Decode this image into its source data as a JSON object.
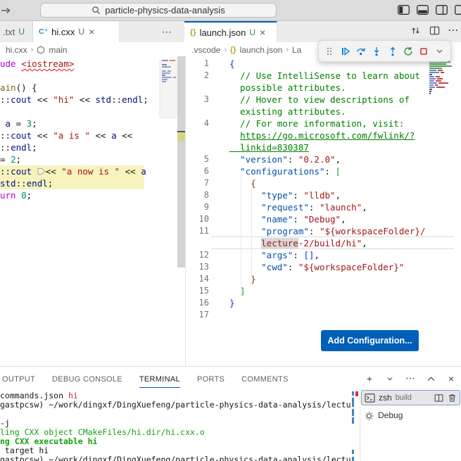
{
  "titlebar": {
    "command_center": "particle-physics-data-analysis"
  },
  "editor_tabs": {
    "left": [
      {
        "label": ".txt",
        "badge": "U"
      },
      {
        "label": "hi.cxx",
        "badge": "U"
      }
    ],
    "right": [
      {
        "label": "launch.json",
        "badge": "U"
      }
    ],
    "more_glyph": "⋯",
    "close_glyph": "×"
  },
  "icons": {
    "cpp_file": "C⁺",
    "json_braces": "{}",
    "more": "⋯",
    "close": "×",
    "plus": "+"
  },
  "breadcrumbs": {
    "left": [
      "hi.cxx",
      "main"
    ],
    "right": [
      ".vscode",
      "launch.json",
      "La"
    ],
    "sep": "›"
  },
  "left_editor": {
    "lines": [
      {
        "t": [
          [
            "kw",
            "ude"
          ],
          [
            "pl",
            " "
          ],
          [
            "str sq",
            "<iostream>"
          ]
        ]
      },
      {
        "t": []
      },
      {
        "t": [
          [
            "fn",
            "ain"
          ],
          [
            "pl",
            "() {"
          ]
        ]
      },
      {
        "t": [
          [
            "pl",
            "::"
          ],
          [
            "var",
            "cout"
          ],
          [
            "pl",
            " << "
          ],
          [
            "str",
            "\"hi\""
          ],
          [
            "pl",
            " << "
          ],
          [
            "var",
            "std"
          ],
          [
            "pl",
            "::"
          ],
          [
            "var",
            "endl"
          ],
          [
            "pl",
            ";"
          ]
        ]
      },
      {
        "t": []
      },
      {
        "t": [
          [
            "pl",
            " "
          ],
          [
            "var",
            "a"
          ],
          [
            "pl",
            " = "
          ],
          [
            "num",
            "3"
          ],
          [
            "pl",
            ";"
          ]
        ]
      },
      {
        "t": [
          [
            "pl",
            "::"
          ],
          [
            "var",
            "cout"
          ],
          [
            "pl",
            " << "
          ],
          [
            "str",
            "\"a is \""
          ],
          [
            "pl",
            " << "
          ],
          [
            "var",
            "a"
          ],
          [
            "pl",
            " <<"
          ]
        ]
      },
      {
        "t": [
          [
            "pl",
            "::"
          ],
          [
            "var",
            "endl"
          ],
          [
            "pl",
            ";"
          ]
        ]
      },
      {
        "t": [
          [
            "pl",
            "= "
          ],
          [
            "num",
            "2"
          ],
          [
            "pl",
            ";"
          ]
        ]
      },
      {
        "cls": "hl",
        "t": [
          [
            "pl",
            "::"
          ],
          [
            "var",
            "cout"
          ],
          [
            "pl",
            " "
          ],
          [
            "pent",
            ""
          ],
          [
            "pl",
            "<< "
          ],
          [
            "str",
            "\"a now is \""
          ],
          [
            "pl",
            " << "
          ],
          [
            "var",
            "a"
          ]
        ]
      },
      {
        "cls": "hl",
        "t": [
          [
            "var",
            "std"
          ],
          [
            "pl",
            "::"
          ],
          [
            "var",
            "endl"
          ],
          [
            "pl",
            ";"
          ]
        ]
      },
      {
        "t": [
          [
            "kw",
            "urn"
          ],
          [
            "pl",
            " "
          ],
          [
            "num",
            "0"
          ],
          [
            "pl",
            ";"
          ]
        ]
      }
    ]
  },
  "right_editor": {
    "rows": [
      {
        "n": "1",
        "t": [
          [
            "b1",
            "{"
          ]
        ]
      },
      {
        "n": "2",
        "t": [
          [
            "cm",
            "  // Use IntelliSense to learn about"
          ]
        ]
      },
      {
        "n": "",
        "t": [
          [
            "cm",
            "  possible attributes."
          ]
        ]
      },
      {
        "n": "3",
        "t": [
          [
            "cm",
            "  // Hover to view descriptions of"
          ]
        ]
      },
      {
        "n": "",
        "t": [
          [
            "cm",
            "  existing attributes."
          ]
        ]
      },
      {
        "n": "4",
        "t": [
          [
            "cm",
            "  // For more information, visit:"
          ]
        ]
      },
      {
        "n": "",
        "t": [
          [
            "cm",
            "  "
          ],
          [
            "cm lnk",
            "https://go.microsoft.com/fwlink/?"
          ]
        ]
      },
      {
        "n": "",
        "t": [
          [
            "cm lnk",
            "  linkid=830387"
          ]
        ]
      },
      {
        "n": "5",
        "t": [
          [
            "key",
            "  \"version\""
          ],
          [
            "pl",
            ": "
          ],
          [
            "str",
            "\"0.2.0\""
          ],
          [
            "pl",
            ","
          ]
        ]
      },
      {
        "n": "6",
        "t": [
          [
            "key",
            "  \"configurations\""
          ],
          [
            "pl",
            ": "
          ],
          [
            "b2",
            "["
          ]
        ]
      },
      {
        "n": "7",
        "t": [
          [
            "b3",
            "    {"
          ]
        ]
      },
      {
        "n": "8",
        "t": [
          [
            "key",
            "      \"type\""
          ],
          [
            "pl",
            ": "
          ],
          [
            "str",
            "\"lldb\""
          ],
          [
            "pl",
            ","
          ]
        ]
      },
      {
        "n": "9",
        "t": [
          [
            "key",
            "      \"request\""
          ],
          [
            "pl",
            ": "
          ],
          [
            "str",
            "\"launch\""
          ],
          [
            "pl",
            ","
          ]
        ]
      },
      {
        "n": "10",
        "t": [
          [
            "key",
            "      \"name\""
          ],
          [
            "pl",
            ": "
          ],
          [
            "str",
            "\"Debug\""
          ],
          [
            "pl",
            ","
          ]
        ]
      },
      {
        "n": "11",
        "t": [
          [
            "key",
            "      \"program\""
          ],
          [
            "pl",
            ": "
          ],
          [
            "str",
            "\"${workspaceFolder}/"
          ]
        ]
      },
      {
        "n": "",
        "cls": "cur",
        "t": [
          [
            "pl",
            "      "
          ],
          [
            "str sel",
            "lecture"
          ],
          [
            "str",
            "-2/build/hi\""
          ],
          [
            "pl",
            ","
          ]
        ]
      },
      {
        "n": "12",
        "t": [
          [
            "key",
            "      \"args\""
          ],
          [
            "pl",
            ": "
          ],
          [
            "b1",
            "[]"
          ],
          [
            "pl",
            ","
          ]
        ]
      },
      {
        "n": "13",
        "t": [
          [
            "key",
            "      \"cwd\""
          ],
          [
            "pl",
            ": "
          ],
          [
            "str",
            "\"${workspaceFolder}\""
          ]
        ]
      },
      {
        "n": "14",
        "t": [
          [
            "b3",
            "    }"
          ]
        ]
      },
      {
        "n": "15",
        "t": [
          [
            "b2",
            "  ]"
          ]
        ]
      },
      {
        "n": "16",
        "t": [
          [
            "b1",
            "}"
          ]
        ]
      },
      {
        "n": "17",
        "t": []
      }
    ]
  },
  "add_configuration": {
    "label": "Add Configuration..."
  },
  "panel": {
    "tabs": [
      "OUTPUT",
      "DEBUG CONSOLE",
      "TERMINAL",
      "PORTS",
      "COMMENTS"
    ],
    "active_tab": "TERMINAL"
  },
  "terminal": {
    "lines": [
      {
        "t": [
          [
            "pl",
            "commands.json "
          ],
          [
            "tred",
            "hi"
          ]
        ]
      },
      {
        "t": [
          [
            "pl",
            "gastpcsw) ~/work/dingxf/DingXuefeng/particle-physics-data-analysis/lectur"
          ]
        ]
      },
      {
        "t": []
      },
      {
        "t": [
          [
            "pl",
            "-j"
          ]
        ]
      },
      {
        "t": [
          [
            "tgreen",
            "ling CXX object CMakeFiles/hi.dir/hi.cxx.o"
          ]
        ]
      },
      {
        "t": [
          [
            "tgreen b",
            "ng CXX executable hi"
          ]
        ]
      },
      {
        "t": [
          [
            "pl",
            " target hi"
          ]
        ]
      },
      {
        "t": [
          [
            "pl",
            "gastpcsw) ~/work/dingxf/DingXuefeng/particle-physics-data-analysis/lectur"
          ]
        ]
      }
    ]
  },
  "terminal_list": [
    {
      "label": "zsh",
      "detail": "build"
    },
    {
      "label": "Debug"
    }
  ]
}
